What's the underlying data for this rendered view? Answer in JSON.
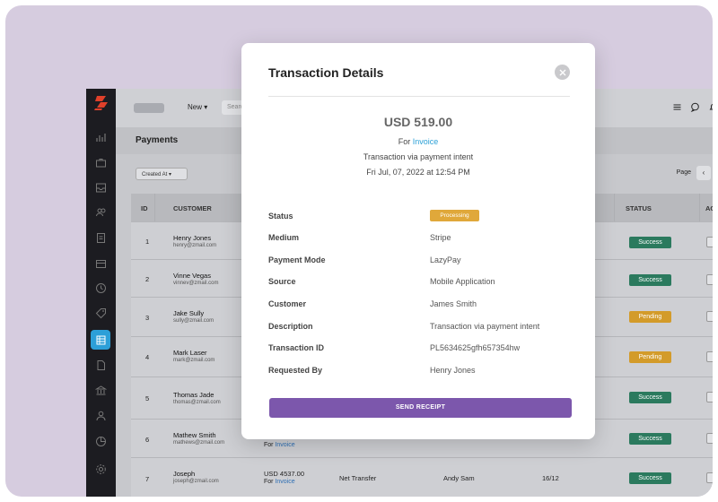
{
  "topbar": {
    "new_label": "New ▾",
    "search_placeholder": "Searc"
  },
  "page": {
    "title": "Payments",
    "filter_label": "Created At",
    "pagination_label": "Page",
    "prev_label": "‹"
  },
  "table": {
    "headers": {
      "id": "ID",
      "customer": "CUSTOMER",
      "status": "STATUS",
      "actions": "ACT"
    },
    "rows": [
      {
        "id": "1",
        "name": "Henry Jones",
        "email": "henry@zmail.com",
        "status": "Success",
        "status_type": "success"
      },
      {
        "id": "2",
        "name": "Vinne Vegas",
        "email": "vinnev@zmail.com",
        "status": "Success",
        "status_type": "success"
      },
      {
        "id": "3",
        "name": "Jake Sully",
        "email": "sully@zmail.com",
        "status": "Pending",
        "status_type": "pending"
      },
      {
        "id": "4",
        "name": "Mark Laser",
        "email": "mark@zmail.com",
        "status": "Pending",
        "status_type": "pending"
      },
      {
        "id": "5",
        "name": "Thomas Jade",
        "email": "thomas@zmail.com",
        "status": "Success",
        "status_type": "success"
      },
      {
        "id": "6",
        "name": "Mathew Smith",
        "email": "mathews@zmail.com",
        "amount_for": "For",
        "amount_link": "Invoice",
        "status": "Success",
        "status_type": "success"
      },
      {
        "id": "7",
        "name": "Joseph",
        "email": "joseph@zmail.com",
        "amount": "USD 4537.00",
        "amount_for": "For",
        "amount_link": "Invoice",
        "medium": "Net Transfer",
        "requested_by": "Andy Sam",
        "date": "16/12",
        "status": "Success",
        "status_type": "success"
      }
    ]
  },
  "modal": {
    "title": "Transaction Details",
    "amount": "USD 519.00",
    "for_prefix": "For",
    "for_link": "Invoice",
    "subtitle": "Transaction via payment intent",
    "date": "Fri Jul, 07, 2022 at 12:54 PM",
    "status_label": "Status",
    "status_value": "Processing",
    "details": [
      {
        "label": "Medium",
        "value": "Stripe"
      },
      {
        "label": "Payment Mode",
        "value": "LazyPay"
      },
      {
        "label": "Source",
        "value": "Mobile Application"
      },
      {
        "label": "Customer",
        "value": "James Smith"
      },
      {
        "label": "Description",
        "value": "Transaction via payment intent"
      },
      {
        "label": "Transaction ID",
        "value": "PL5634625gfh657354hw"
      },
      {
        "label": "Requested By",
        "value": "Henry Jones"
      }
    ],
    "send_label": "SEND RECEIPT"
  },
  "colors": {
    "accent": "#7c57ac",
    "active_nav": "#2c9fd8",
    "success": "#2b7a5e",
    "pending": "#d39b2a",
    "processing": "#e0a83a",
    "link": "#2ba0d6"
  }
}
